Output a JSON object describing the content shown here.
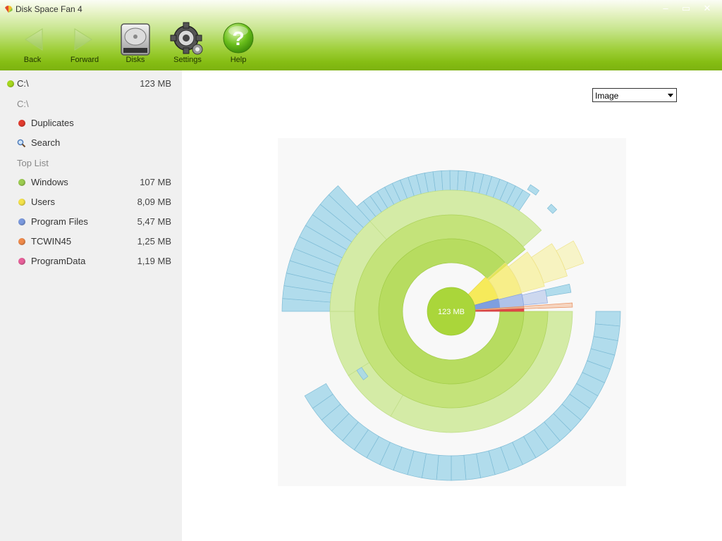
{
  "window": {
    "title": "Disk Space Fan 4",
    "controls": [
      "–",
      "▭",
      "✕"
    ]
  },
  "toolbar": {
    "back_label": "Back",
    "forward_label": "Forward",
    "disks_label": "Disks",
    "settings_label": "Settings",
    "help_label": "Help"
  },
  "sidebar": {
    "root": {
      "label": "C:\\",
      "size": "123 MB",
      "color": "#a6d81e"
    },
    "path_label": "C:\\",
    "duplicates_label": "Duplicates",
    "search_label": "Search",
    "toplist_header": "Top List",
    "toplist": [
      {
        "label": "Windows",
        "size": "107 MB",
        "color": "#9ccc50"
      },
      {
        "label": "Users",
        "size": "8,09 MB",
        "color": "#f4e24a"
      },
      {
        "label": "Program Files",
        "size": "5,47 MB",
        "color": "#7a99de"
      },
      {
        "label": "TCWIN45",
        "size": "1,25 MB",
        "color": "#f08a4a"
      },
      {
        "label": "ProgramData",
        "size": "1,19 MB",
        "color": "#e8609a"
      }
    ]
  },
  "view_select": {
    "value": "Image"
  },
  "fan": {
    "center_label": "123 MB",
    "colors": {
      "windows": "#a9d63a",
      "users": "#f6ea5a",
      "program_files": "#7f9fe0",
      "tcwin": "#f2a06c",
      "programdata": "#e04a4a",
      "files": "#a8d8ea"
    }
  }
}
